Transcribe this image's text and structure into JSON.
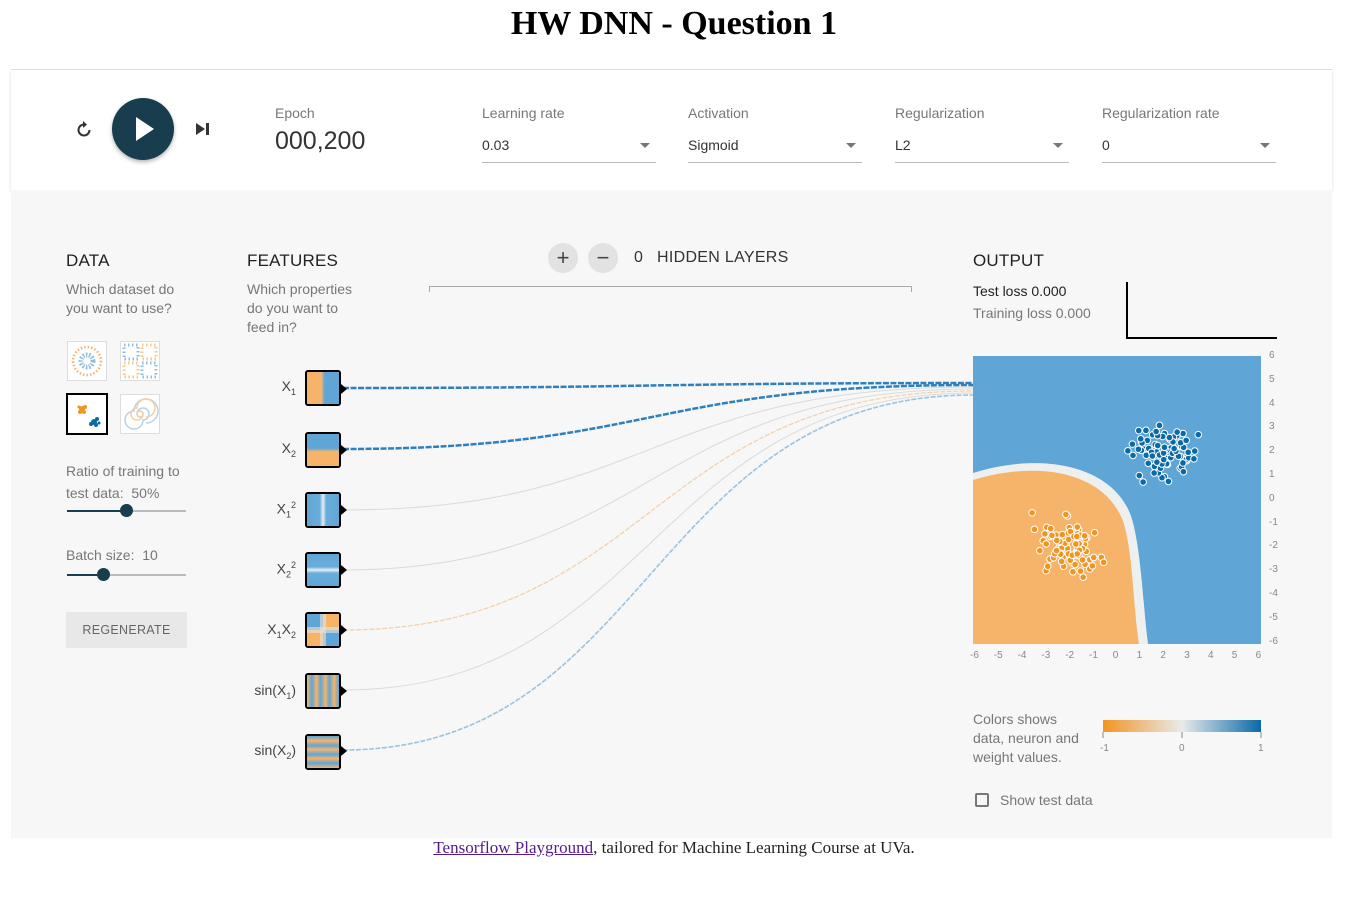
{
  "page": {
    "title": "HW DNN - Question 1"
  },
  "controls": {
    "epoch_label": "Epoch",
    "epoch_value": "000,200",
    "learning_rate": {
      "label": "Learning rate",
      "value": "0.03"
    },
    "activation": {
      "label": "Activation",
      "value": "Sigmoid"
    },
    "regularization": {
      "label": "Regularization",
      "value": "L2"
    },
    "regularization_rate": {
      "label": "Regularization rate",
      "value": "0"
    }
  },
  "data_panel": {
    "title": "DATA",
    "subtitle_line1": "Which dataset do",
    "subtitle_line2": "you want to use?",
    "datasets": [
      "circle",
      "xor",
      "gaussian",
      "spiral"
    ],
    "selected_dataset": "gaussian",
    "ratio_label": "Ratio of training to",
    "ratio_label2": "test data:",
    "ratio_value": "50%",
    "ratio_fraction": 0.5,
    "batch_label": "Batch size:",
    "batch_value": "10",
    "regenerate_label": "REGENERATE"
  },
  "features_panel": {
    "title": "FEATURES",
    "subtitle_line1": "Which properties",
    "subtitle_line2": "do you want to",
    "subtitle_line3": "feed in?",
    "features": [
      {
        "base": "X",
        "sub": "1",
        "sup": ""
      },
      {
        "base": "X",
        "sub": "2",
        "sup": ""
      },
      {
        "base": "X",
        "sub": "1",
        "sup": "2"
      },
      {
        "base": "X",
        "sub": "2",
        "sup": "2"
      },
      {
        "base": "X",
        "sub": "1",
        "mid": "X",
        "sub2": "2"
      },
      {
        "pre": "sin(X",
        "sub": "1",
        "post": ")"
      },
      {
        "pre": "sin(X",
        "sub": "2",
        "post": ")"
      }
    ]
  },
  "network": {
    "add_layer": "+",
    "remove_layer": "−",
    "hidden_layer_count": "0",
    "hidden_layers_label": "HIDDEN LAYERS"
  },
  "output_panel": {
    "title": "OUTPUT",
    "test_loss_label": "Test loss",
    "test_loss_value": "0.000",
    "training_loss_label": "Training loss",
    "training_loss_value": "0.000",
    "y_ticks": [
      "6",
      "5",
      "4",
      "3",
      "2",
      "1",
      "0",
      "-1",
      "-2",
      "-3",
      "-4",
      "-5",
      "-6"
    ],
    "x_ticks": [
      "-6",
      "-5",
      "-4",
      "-3",
      "-2",
      "-1",
      "0",
      "1",
      "2",
      "3",
      "4",
      "5",
      "6"
    ],
    "legend_line1": "Colors shows",
    "legend_line2": "data, neuron and",
    "legend_line3": "weight values.",
    "legend_min": "-1",
    "legend_mid": "0",
    "legend_max": "1",
    "show_test_label": "Show test data",
    "colors": {
      "orange": "#f5b46a",
      "blue": "#5fa6d6",
      "dark_blue": "#0a6aa8",
      "dark_orange": "#f19522"
    }
  },
  "footer": {
    "link_text": "Tensorflow Playground",
    "rest_text": ", tailored for Machine Learning Course at UVa."
  }
}
